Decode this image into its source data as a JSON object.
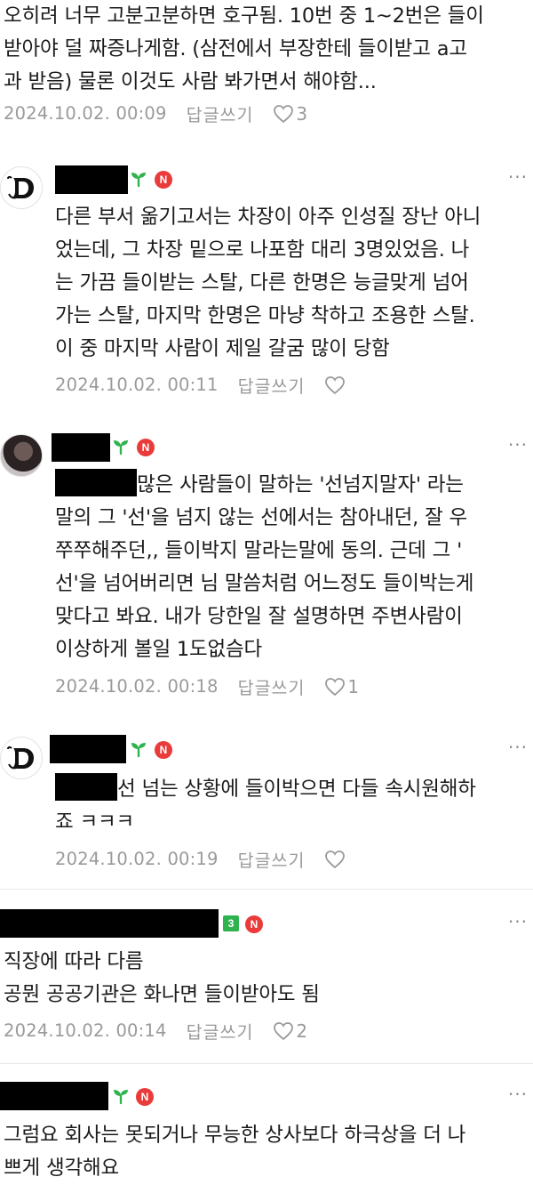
{
  "comments": [
    {
      "lines": [
        "오히려 너무 고분고분하면 호구됨. 10번 중 1~2번은 들이",
        "받아야 덜 짜증나게함. (삼전에서 부장한테 들이받고 a고",
        "과 받음) 물론 이것도 사람 봐가면서 해야함..."
      ],
      "date": "2024.10.02. 00:09",
      "reply": "답글쓰기",
      "likes": "3"
    },
    {
      "avatar": "gothic-d-logo",
      "lines": [
        "다른 부서 옮기고서는 차장이 아주 인성질 장난 아니",
        "었는데, 그 차장 밑으로 나포함 대리 3명있었음. 나",
        "는 가끔 들이받는 스탈, 다른 한명은 능글맞게 넘어",
        "가는 스탈, 마지막 한명은 마냥 착하고 조용한 스탈.",
        "이 중 마지막 사람이 제일 갈굼 많이 당함"
      ],
      "date": "2024.10.02. 00:11",
      "reply": "답글쓰기",
      "likes": ""
    },
    {
      "avatar": "profile-photo",
      "first_line": "많은 사람들이 말하는 '선넘지말자' 라는",
      "lines": [
        "말의 그 '선'을 넘지 않는 선에서는 참아내던, 잘 우",
        "쭈쭈해주던,, 들이박지 말라는말에 동의. 근데 그 '",
        "선'을 넘어버리면 님 말씀처럼 어느정도 들이박는게",
        "맞다고 봐요. 내가 당한일 잘 설명하면 주변사람이",
        "이상하게 볼일 1도없슴다"
      ],
      "date": "2024.10.02. 00:18",
      "reply": "답글쓰기",
      "likes": "1"
    },
    {
      "avatar": "gothic-d-logo",
      "first_line": "선 넘는 상황에 들이박으면 다들 속시원해하",
      "lines": [
        "죠 ㅋㅋㅋ"
      ],
      "date": "2024.10.02. 00:19",
      "reply": "답글쓰기",
      "likes": ""
    },
    {
      "level": "3",
      "lines": [
        "직장에 따라 다름",
        "공뭔 공공기관은 화나면 들이받아도 됨"
      ],
      "date": "2024.10.02. 00:14",
      "reply": "답글쓰기",
      "likes": "2"
    },
    {
      "lines": [
        "그럼요 회사는 못되거나 무능한 상사보다 하극상을 더 나",
        "쁘게 생각해요"
      ]
    }
  ],
  "badges": {
    "n": "N",
    "more": "···"
  },
  "colors": {
    "new_badge": "#ea3b3b",
    "sprout": "#2fb34e",
    "meta_text": "#9a9a9a"
  }
}
